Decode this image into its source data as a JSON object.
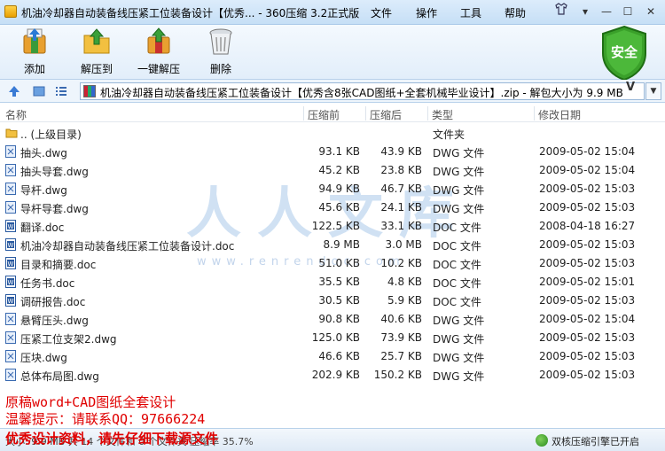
{
  "window": {
    "title": "机油冷却器自动装备线压紧工位装备设计【优秀... - 360压缩 3.2正式版",
    "menus": [
      "文件",
      "操作",
      "工具",
      "帮助"
    ]
  },
  "toolbar": {
    "add": "添加",
    "extract_to": "解压到",
    "one_click": "一键解压",
    "delete": "删除"
  },
  "security_badge": "安全",
  "address": {
    "path": "机油冷却器自动装备线压紧工位装备设计【优秀含8张CAD图纸+全套机械毕业设计】.zip - 解包大小为 9.9 MB",
    "v": "V"
  },
  "columns": {
    "name": "名称",
    "compressed": "压缩前",
    "original": "压缩后",
    "type": "类型",
    "modified": "修改日期"
  },
  "rows": [
    {
      "icon": "folder",
      "name": ".. (上级目录)",
      "csize": "",
      "osize": "",
      "type": "文件夹",
      "date": ""
    },
    {
      "icon": "dwg",
      "name": "抽头.dwg",
      "csize": "93.1 KB",
      "osize": "43.9 KB",
      "type": "DWG 文件",
      "date": "2009-05-02 15:04"
    },
    {
      "icon": "dwg",
      "name": "抽头导套.dwg",
      "csize": "45.2 KB",
      "osize": "23.8 KB",
      "type": "DWG 文件",
      "date": "2009-05-02 15:04"
    },
    {
      "icon": "dwg",
      "name": "导杆.dwg",
      "csize": "94.9 KB",
      "osize": "46.7 KB",
      "type": "DWG 文件",
      "date": "2009-05-02 15:03"
    },
    {
      "icon": "dwg",
      "name": "导杆导套.dwg",
      "csize": "45.6 KB",
      "osize": "24.1 KB",
      "type": "DWG 文件",
      "date": "2009-05-02 15:03"
    },
    {
      "icon": "doc",
      "name": "翻译.doc",
      "csize": "122.5 KB",
      "osize": "33.1 KB",
      "type": "DOC 文件",
      "date": "2008-04-18 16:27"
    },
    {
      "icon": "doc",
      "name": "机油冷却器自动装备线压紧工位装备设计.doc",
      "csize": "8.9 MB",
      "osize": "3.0 MB",
      "type": "DOC 文件",
      "date": "2009-05-02 15:03"
    },
    {
      "icon": "doc",
      "name": "目录和摘要.doc",
      "csize": "51.0 KB",
      "osize": "10.2 KB",
      "type": "DOC 文件",
      "date": "2009-05-02 15:03"
    },
    {
      "icon": "doc",
      "name": "任务书.doc",
      "csize": "35.5 KB",
      "osize": "4.8 KB",
      "type": "DOC 文件",
      "date": "2009-05-02 15:01"
    },
    {
      "icon": "doc",
      "name": "调研报告.doc",
      "csize": "30.5 KB",
      "osize": "5.9 KB",
      "type": "DOC 文件",
      "date": "2009-05-02 15:03"
    },
    {
      "icon": "dwg",
      "name": "悬臂压头.dwg",
      "csize": "90.8 KB",
      "osize": "40.6 KB",
      "type": "DWG 文件",
      "date": "2009-05-02 15:04"
    },
    {
      "icon": "dwg",
      "name": "压紧工位支架2.dwg",
      "csize": "125.0 KB",
      "osize": "73.9 KB",
      "type": "DWG 文件",
      "date": "2009-05-02 15:03"
    },
    {
      "icon": "dwg",
      "name": "压块.dwg",
      "csize": "46.6 KB",
      "osize": "25.7 KB",
      "type": "DWG 文件",
      "date": "2009-05-02 15:03"
    },
    {
      "icon": "dwg",
      "name": "总体布局图.dwg",
      "csize": "202.9 KB",
      "osize": "150.2 KB",
      "type": "DWG 文件",
      "date": "2009-05-02 15:03"
    }
  ],
  "watermark": {
    "main": "人人文库",
    "url": "www.renrendoc.com"
  },
  "statusbar": {
    "left": "大小: 9.9 MB 共 14 个文件和 0 个文件夹 压缩率 35.7%",
    "right": "双核压缩引擎已开启"
  },
  "overlay": {
    "line1": "原稿word+CAD图纸全套设计",
    "line2": "温馨提示：请联系QQ：97666224",
    "line3": "优秀设计资料，请先仔细下载源文件"
  },
  "colors": {
    "accent": "#3a7bd5",
    "overlay_red": "#e00000",
    "badge_green": "#3aa02a"
  }
}
